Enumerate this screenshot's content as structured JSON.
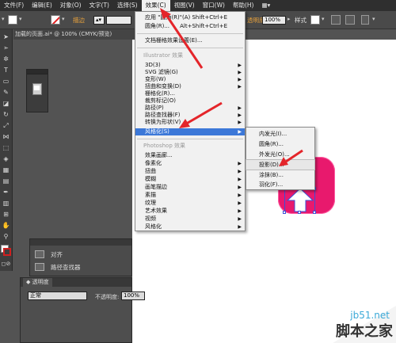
{
  "menubar": {
    "items": [
      "文件(F)",
      "编辑(E)",
      "对象(O)",
      "文字(T)",
      "选择(S)",
      "效果(C)",
      "视图(V)",
      "窗口(W)",
      "帮助(H)"
    ],
    "active_index": 5
  },
  "controlbar": {
    "stroke_label": "描边",
    "style_label": "样式",
    "opacity_value": "100%",
    "transparency_label": "透明度"
  },
  "document_tab": {
    "title": "加载的页面.ai* @ 100% (CMYK/预览)"
  },
  "effect_menu": {
    "apply_last": {
      "label": "应用 \"圆角(R)\"(A)",
      "shortcut": "Shift+Ctrl+E"
    },
    "last_effect": {
      "label": "圆角(R)...",
      "shortcut": "Alt+Shift+Ctrl+E"
    },
    "doc_raster": "文档栅格效果设置(E)...",
    "illustrator_header": "Illustrator 效果",
    "illustrator_items": [
      "3D(3)",
      "SVG 滤镜(G)",
      "变形(W)",
      "扭曲和变换(D)",
      "栅格化(R)...",
      "裁剪标记(O)",
      "路径(P)",
      "路径查找器(F)",
      "转换为形状(V)",
      "风格化(S)"
    ],
    "highlighted_index": 9,
    "photoshop_header": "Photoshop 效果",
    "photoshop_items": [
      "效果画廊...",
      "像素化",
      "扭曲",
      "模糊",
      "画笔描边",
      "素描",
      "纹理",
      "艺术效果",
      "视频",
      "风格化"
    ]
  },
  "stylize_submenu": {
    "items": [
      "内发光(I)...",
      "圆角(R)...",
      "外发光(O)...",
      "投影(D)...",
      "涂抹(B)...",
      "羽化(F)..."
    ],
    "highlighted_index": 3
  },
  "dock_panel": {
    "items": [
      "对齐",
      "路径查找器"
    ]
  },
  "transparency_panel": {
    "tab_label": "透明度",
    "blend_mode": "正常",
    "opacity_label": "不透明度:",
    "opacity_value": "100%"
  },
  "watermark": {
    "site": "jb51.net",
    "name": "脚本之家"
  },
  "colors": {
    "highlight": "#3c78d8",
    "accent_pink": "#e8196d",
    "arrow_red": "#e4252a"
  }
}
